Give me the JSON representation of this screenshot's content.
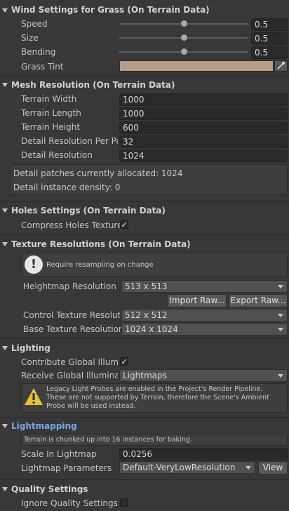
{
  "wind": {
    "title": "Wind Settings for Grass (On Terrain Data)",
    "speed_label": "Speed",
    "speed_value": "0.5",
    "speed_fraction": 0.5,
    "size_label": "Size",
    "size_value": "0.5",
    "size_fraction": 0.5,
    "bending_label": "Bending",
    "bending_value": "0.5",
    "bending_fraction": 0.5,
    "grass_tint_label": "Grass Tint",
    "grass_tint_color": "#b69b86"
  },
  "mesh": {
    "title": "Mesh Resolution (On Terrain Data)",
    "terrain_width_label": "Terrain Width",
    "terrain_width": "1000",
    "terrain_length_label": "Terrain Length",
    "terrain_length": "1000",
    "terrain_height_label": "Terrain Height",
    "terrain_height": "600",
    "detail_per_patch_label": "Detail Resolution Per Pat",
    "detail_per_patch": "32",
    "detail_resolution_label": "Detail Resolution",
    "detail_resolution": "1024",
    "info_line1": "Detail patches currently allocated: 1024",
    "info_line2": "Detail instance density: 0"
  },
  "holes": {
    "title": "Holes Settings (On Terrain Data)",
    "compress_label": "Compress Holes Texture",
    "compress_checked": true
  },
  "texres": {
    "title": "Texture Resolutions (On Terrain Data)",
    "notice": "Require resampling on change",
    "heightmap_label": "Heightmap Resolution",
    "heightmap_value": "513 x 513",
    "import_raw": "Import Raw...",
    "export_raw": "Export Raw...",
    "control_label": "Control Texture Resolutio",
    "control_value": "512 x 512",
    "base_label": "Base Texture Resolution",
    "base_value": "1024 x 1024"
  },
  "lighting": {
    "title": "Lighting",
    "contribute_label": "Contribute Global Illumin",
    "contribute_checked": true,
    "receive_label": "Receive Global Illuminati",
    "receive_value": "Lightmaps",
    "warning_line1": "Legacy Light Probes are enabled in the Project's Render Pipeline.",
    "warning_line2": "These are not supported by Terrain, therefore the Scene's Ambient",
    "warning_line3": "Probe will be used instead."
  },
  "lightmapping": {
    "title": "Lightmapping",
    "chunk_info": "Terrain is chunked up into 16 instances for baking.",
    "scale_label": "Scale In Lightmap",
    "scale_value": "0.0256",
    "params_label": "Lightmap Parameters",
    "params_value": "Default-VeryLowResolution",
    "view_button": "View"
  },
  "quality": {
    "title": "Quality Settings",
    "ignore_label": "Ignore Quality Settings",
    "ignore_checked": false
  },
  "colors": {
    "link": "#7ba7e8",
    "warning": "#e8c233"
  },
  "icons": {
    "foldout": "triangle-down-icon",
    "eyedropper": "eyedropper-icon",
    "info": "info-icon",
    "warning": "warning-icon",
    "check": "checkmark-icon"
  }
}
